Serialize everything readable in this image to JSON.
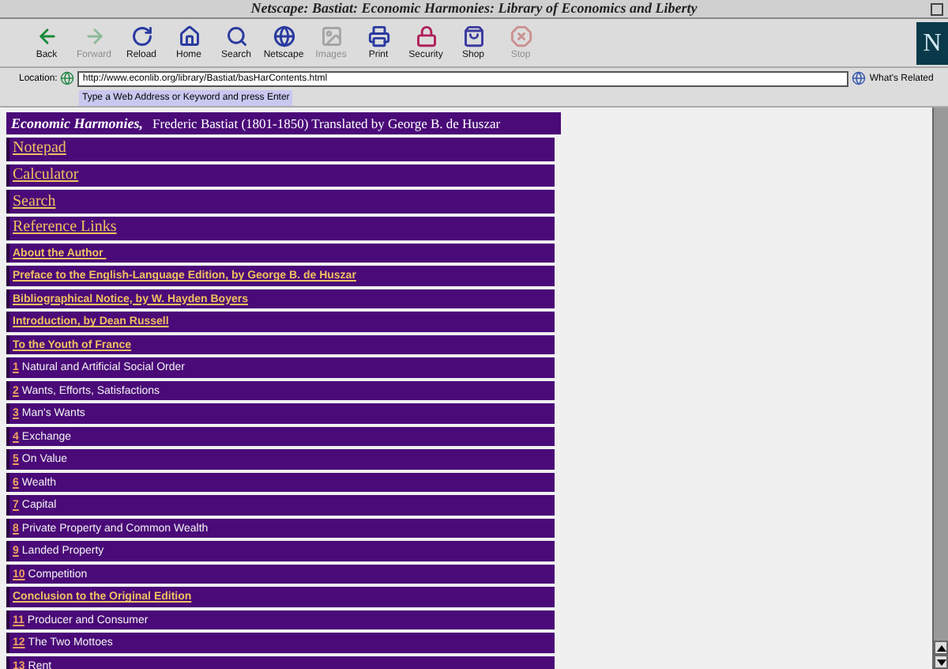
{
  "window": {
    "title": "Netscape: Bastiat: Economic Harmonies: Library of Economics and Liberty"
  },
  "toolbar": [
    {
      "label": "Back",
      "disabled": false
    },
    {
      "label": "Forward",
      "disabled": true
    },
    {
      "label": "Reload",
      "disabled": false
    },
    {
      "label": "Home",
      "disabled": false
    },
    {
      "label": "Search",
      "disabled": false
    },
    {
      "label": "Netscape",
      "disabled": false
    },
    {
      "label": "Images",
      "disabled": true
    },
    {
      "label": "Print",
      "disabled": false
    },
    {
      "label": "Security",
      "disabled": false
    },
    {
      "label": "Shop",
      "disabled": false
    },
    {
      "label": "Stop",
      "disabled": true
    }
  ],
  "logo": "N",
  "location": {
    "label": "Location:",
    "value": "http://www.econlib.org/library/Bastiat/basHarContents.html",
    "hint": "Type a Web Address or Keyword and press Enter",
    "related": "What's Related"
  },
  "page": {
    "header": {
      "book": "Economic Harmonies,",
      "byline": "Frederic Bastiat (1801-1850) Translated by George B. de Huszar"
    },
    "items": [
      {
        "kind": "big",
        "text": "Notepad"
      },
      {
        "kind": "big",
        "text": "Calculator"
      },
      {
        "kind": "big",
        "text": "Search"
      },
      {
        "kind": "big",
        "text": "Reference Links"
      },
      {
        "kind": "small",
        "text": "About the Author "
      },
      {
        "kind": "small",
        "text": "Preface to the English-Language Edition, by George B. de Huszar"
      },
      {
        "kind": "small",
        "text": "Bibliographical Notice, by W. Hayden Boyers"
      },
      {
        "kind": "small",
        "text": "Introduction, by Dean Russell"
      },
      {
        "kind": "small",
        "text": "To the Youth of France"
      },
      {
        "kind": "chapter",
        "number": "1",
        "text": "Natural and Artificial Social Order"
      },
      {
        "kind": "chapter",
        "number": "2",
        "text": "Wants, Efforts, Satisfactions"
      },
      {
        "kind": "chapter",
        "number": "3",
        "text": "Man's Wants"
      },
      {
        "kind": "chapter",
        "number": "4",
        "text": "Exchange"
      },
      {
        "kind": "chapter",
        "number": "5",
        "text": "On Value"
      },
      {
        "kind": "chapter",
        "number": "6",
        "text": "Wealth"
      },
      {
        "kind": "chapter",
        "number": "7",
        "text": "Capital"
      },
      {
        "kind": "chapter",
        "number": "8",
        "text": "Private Property and Common Wealth"
      },
      {
        "kind": "chapter",
        "number": "9",
        "text": "Landed Property"
      },
      {
        "kind": "chapter",
        "number": "10",
        "text": "Competition"
      },
      {
        "kind": "small",
        "text": "Conclusion to the Original Edition"
      },
      {
        "kind": "chapter",
        "number": "11",
        "text": "Producer and Consumer"
      },
      {
        "kind": "chapter",
        "number": "12",
        "text": "The Two Mottoes"
      },
      {
        "kind": "chapter",
        "number": "13",
        "text": "Rent"
      }
    ]
  }
}
